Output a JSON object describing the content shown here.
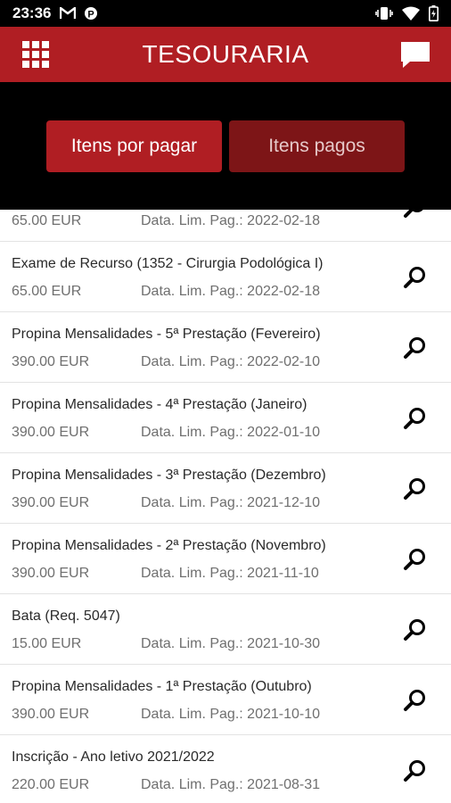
{
  "status_bar": {
    "time": "23:36",
    "left_icons": [
      "gmail-icon",
      "parking-icon"
    ],
    "right_icons": [
      "vibrate-icon",
      "wifi-icon",
      "battery-icon"
    ]
  },
  "app_bar": {
    "title": "TESOURARIA",
    "menu_icon": "grid-menu-icon",
    "action_icon": "chat-icon",
    "color": "#b01e23"
  },
  "tabs": [
    {
      "label": "Itens por pagar",
      "active": true
    },
    {
      "label": "Itens pagos",
      "active": false
    }
  ],
  "items": [
    {
      "title": "",
      "amount": "65.00 EUR",
      "date": "Data. Lim. Pag.: 2022-02-18"
    },
    {
      "title": "Exame de Recurso (1352 - Cirurgia Podológica I)",
      "amount": "65.00 EUR",
      "date": "Data. Lim. Pag.: 2022-02-18"
    },
    {
      "title": "Propina Mensalidades - 5ª Prestação (Fevereiro)",
      "amount": "390.00 EUR",
      "date": "Data. Lim. Pag.: 2022-02-10"
    },
    {
      "title": "Propina Mensalidades - 4ª Prestação (Janeiro)",
      "amount": "390.00 EUR",
      "date": "Data. Lim. Pag.: 2022-01-10"
    },
    {
      "title": "Propina Mensalidades - 3ª Prestação (Dezembro)",
      "amount": "390.00 EUR",
      "date": "Data. Lim. Pag.: 2021-12-10"
    },
    {
      "title": "Propina Mensalidades - 2ª Prestação (Novembro)",
      "amount": "390.00 EUR",
      "date": "Data. Lim. Pag.: 2021-11-10"
    },
    {
      "title": "Bata (Req. 5047)",
      "amount": "15.00 EUR",
      "date": "Data. Lim. Pag.: 2021-10-30"
    },
    {
      "title": "Propina Mensalidades - 1ª Prestação (Outubro)",
      "amount": "390.00 EUR",
      "date": "Data. Lim. Pag.: 2021-10-10"
    },
    {
      "title": "Inscrição - Ano letivo 2021/2022",
      "amount": "220.00 EUR",
      "date": "Data. Lim. Pag.: 2021-08-31"
    }
  ],
  "item_icon": "magnifier-icon"
}
